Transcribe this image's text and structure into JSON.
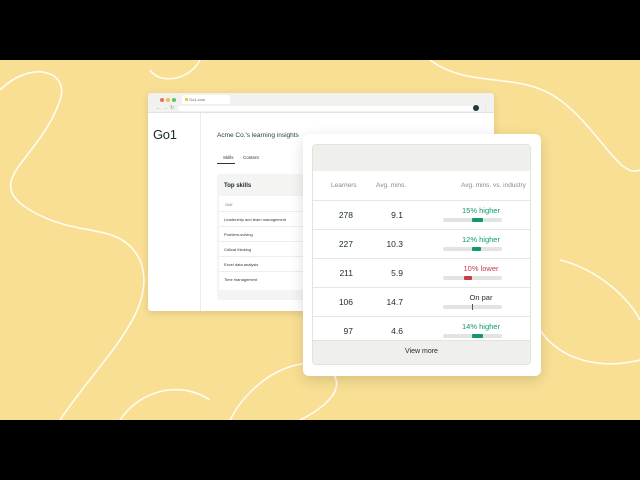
{
  "browser": {
    "tab_title": "Go1.com",
    "window_dots": [
      "#ee6a5f",
      "#f5bd4f",
      "#61c454"
    ]
  },
  "app": {
    "logo": "Go1",
    "insights_title": "Acme Co.'s learning insights",
    "tabs": [
      {
        "label": "Skills",
        "active": true
      },
      {
        "label": "Content",
        "active": false
      }
    ],
    "skills_card": {
      "title": "Top skills",
      "column_header": "Skill",
      "rows": [
        "Leadership and team management",
        "Problem-solving",
        "Critical thinking",
        "Excel data analysis",
        "Time management"
      ]
    }
  },
  "stats_card": {
    "columns": [
      "Learners",
      "Avg. mins.",
      "Avg. mins. vs. industry"
    ],
    "rows": [
      {
        "learners": "278",
        "avg_mins": "9.1",
        "comparison": "15% higher",
        "status": "higher",
        "deviation_fraction": 0.15
      },
      {
        "learners": "227",
        "avg_mins": "10.3",
        "comparison": "12% higher",
        "status": "higher",
        "deviation_fraction": 0.12
      },
      {
        "learners": "211",
        "avg_mins": "5.9",
        "comparison": "10% lower",
        "status": "lower",
        "deviation_fraction": 0.1
      },
      {
        "learners": "106",
        "avg_mins": "14.7",
        "comparison": "On par",
        "status": "par",
        "deviation_fraction": 0
      },
      {
        "learners": "97",
        "avg_mins": "4.6",
        "comparison": "14% higher",
        "status": "higher",
        "deviation_fraction": 0.14
      }
    ],
    "footer_button": "View more"
  },
  "colors": {
    "background": "#f9df93",
    "higher": "#0f9a6e",
    "lower": "#c93b4b",
    "par": "#1b2a2c"
  }
}
